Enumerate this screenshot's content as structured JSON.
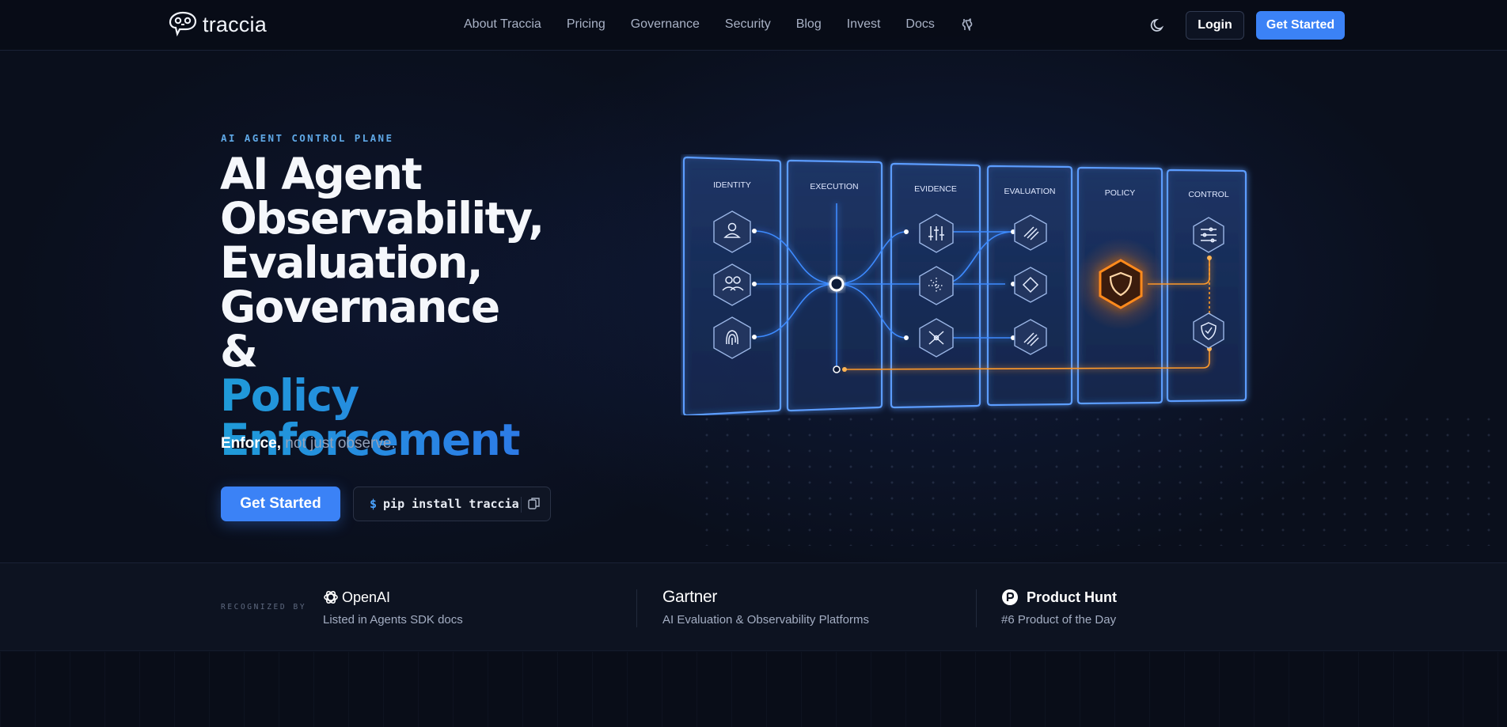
{
  "nav": {
    "logo_text": "traccia",
    "links": [
      "About Traccia",
      "Pricing",
      "Governance",
      "Security",
      "Blog",
      "Invest",
      "Docs"
    ],
    "login_label": "Login",
    "get_started_label": "Get Started"
  },
  "hero": {
    "eyebrow": "AI AGENT CONTROL PLANE",
    "headline_lines": [
      "AI Agent",
      "Observability,",
      "Evaluation,",
      "Governance",
      "&"
    ],
    "headline_highlight": "Policy Enforcement",
    "tagline_strong": "Enforce,",
    "tagline_rest": " not just observe.",
    "cta_label": "Get Started",
    "install_prompt": "$",
    "install_command": "pip install traccia"
  },
  "diagram": {
    "panels": [
      "IDENTITY",
      "EXECUTION",
      "EVIDENCE",
      "EVALUATION",
      "POLICY",
      "CONTROL"
    ],
    "colors": {
      "blue": "#3d8bff",
      "orange": "#ff8a1e"
    }
  },
  "recognized": {
    "label": "RECOGNIZED BY",
    "items": [
      {
        "name": "OpenAI",
        "desc": "Listed in Agents SDK docs"
      },
      {
        "name": "Gartner",
        "desc": "AI Evaluation & Observability Platforms"
      },
      {
        "name": "Product Hunt",
        "desc": "#6 Product of the Day"
      }
    ]
  }
}
